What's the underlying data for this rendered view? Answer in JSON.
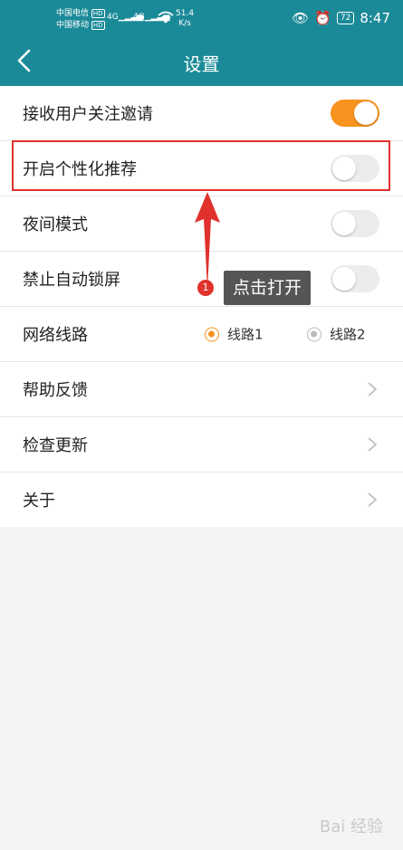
{
  "status_bar": {
    "carrier1": "中国电信",
    "carrier2": "中国移动",
    "hd": "HD",
    "net1": "4G",
    "net2": "4G",
    "speed_value": "51.4",
    "speed_unit": "K/s",
    "battery": "72",
    "time": "8:47"
  },
  "header": {
    "title": "设置",
    "bg_color": "#1b8a98"
  },
  "settings": {
    "receive_follow_invites": {
      "label": "接收用户关注邀请",
      "enabled": true
    },
    "personalized_recommend": {
      "label": "开启个性化推荐",
      "enabled": false
    },
    "night_mode": {
      "label": "夜间模式",
      "enabled": false
    },
    "disable_auto_lock": {
      "label": "禁止自动锁屏",
      "enabled": false
    },
    "network_route": {
      "label": "网络线路",
      "options": [
        "线路1",
        "线路2"
      ],
      "selected": "线路1"
    },
    "help_feedback": {
      "label": "帮助反馈"
    },
    "check_update": {
      "label": "检查更新"
    },
    "about": {
      "label": "关于"
    }
  },
  "annotation": {
    "step": "1",
    "text": "点击打开",
    "color": "#e0322d"
  },
  "watermark": "Bai 经验",
  "colors": {
    "accent": "#f7931e",
    "highlight": "#e0322d"
  }
}
